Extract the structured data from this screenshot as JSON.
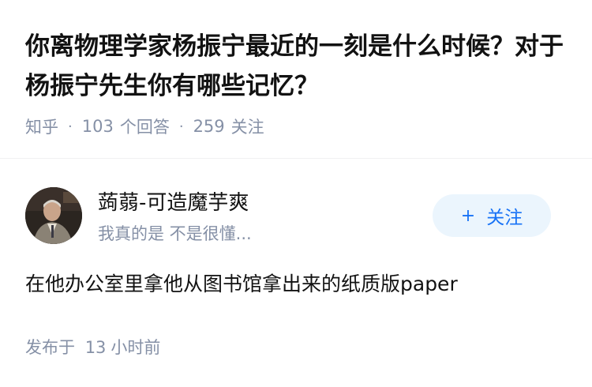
{
  "question": {
    "title": "你离物理学家杨振宁最近的一刻是什么时候？对于杨振宁先生你有哪些记忆？",
    "source": "知乎",
    "answer_count": "103",
    "answer_label": "个回答",
    "follower_count": "259",
    "follower_label": "关注"
  },
  "answer": {
    "author_name": "蒟蒻-可造魔芋爽",
    "author_bio": "我真的是 不是很懂...",
    "follow_label": "关注",
    "follow_icon": "plus-icon",
    "content": "在他办公室里拿他从图书馆拿出来的纸质版paper",
    "publish_prefix": "发布于",
    "publish_time_num": "13",
    "publish_time_unit": "小时前"
  },
  "colors": {
    "title": "#121212",
    "meta": "#8590a6",
    "accent": "#1772f6",
    "follow_bg": "#ebf5fd"
  }
}
